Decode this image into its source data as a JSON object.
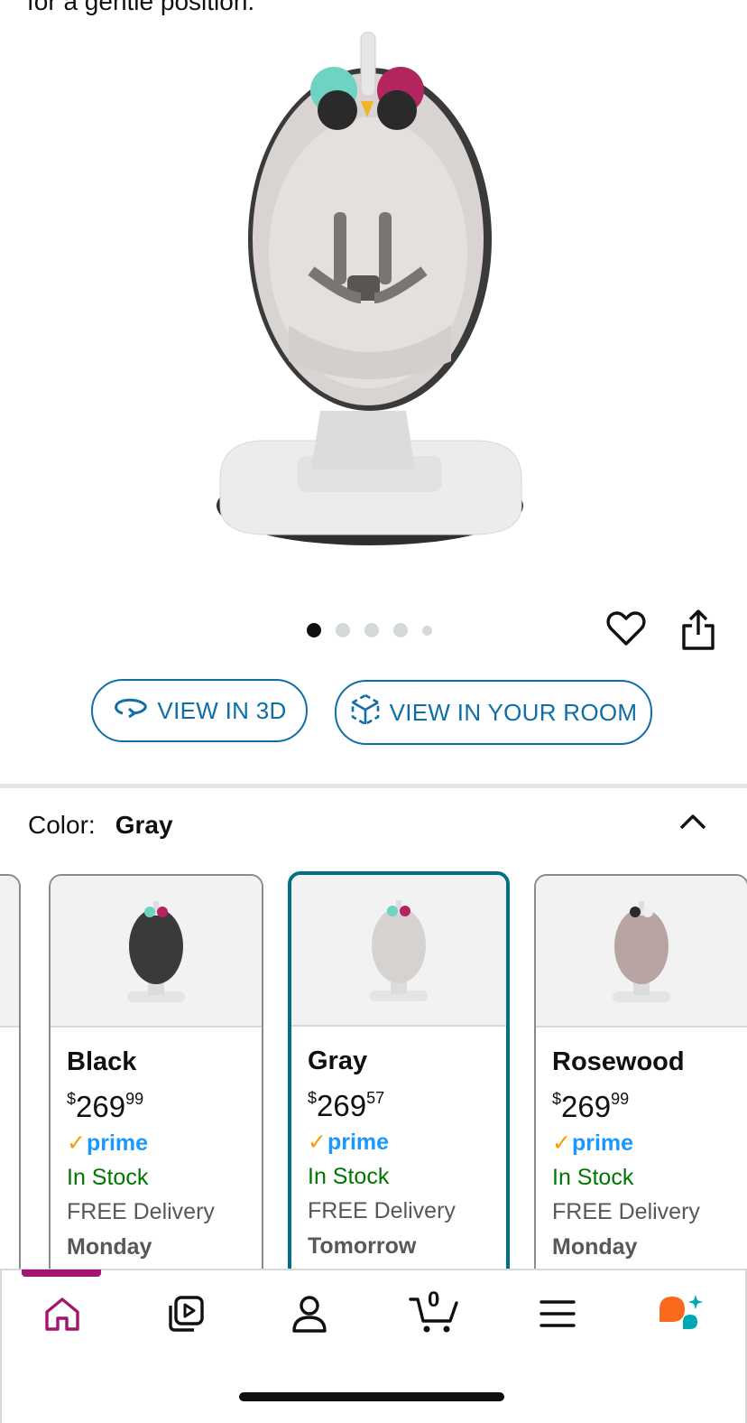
{
  "top_snippet": "for a gentle position.",
  "gallery": {
    "image_alt": "4moms mamaRoo baby swing in gray",
    "dot_count": 5,
    "active_dot": 0
  },
  "actions": {
    "view_3d_label": "VIEW IN 3D",
    "view_room_label": "VIEW IN YOUR ROOM"
  },
  "color": {
    "label": "Color:",
    "value": "Gray"
  },
  "swatches": [
    {
      "name": "Black",
      "price_whole": "269",
      "price_fraction": "99",
      "currency": "$",
      "prime": "prime",
      "stock": "In Stock",
      "delivery": "FREE Delivery",
      "day": "Monday",
      "tone": "#3b3a3a"
    },
    {
      "name": "Gray",
      "price_whole": "269",
      "price_fraction": "57",
      "currency": "$",
      "prime": "prime",
      "stock": "In Stock",
      "delivery": "FREE Delivery",
      "day": "Tomorrow",
      "tone": "#d6d2cf",
      "selected": true
    },
    {
      "name": "Rosewood",
      "price_whole": "269",
      "price_fraction": "99",
      "currency": "$",
      "prime": "prime",
      "stock": "In Stock",
      "delivery": "FREE Delivery",
      "day": "Monday",
      "tone": "#b8a5a3"
    }
  ],
  "tabbar": {
    "items": [
      "home-icon",
      "video-icon",
      "account-icon",
      "cart-icon",
      "menu-icon",
      "rufus-icon"
    ],
    "cart_count": "0",
    "active": "home-icon"
  },
  "colors": {
    "link_blue": "#0f6ea8",
    "selected_teal": "#007185",
    "prime_blue": "#1a98ff",
    "prime_check": "#ff9900",
    "in_stock": "#007600",
    "home_active": "#a1176f"
  }
}
